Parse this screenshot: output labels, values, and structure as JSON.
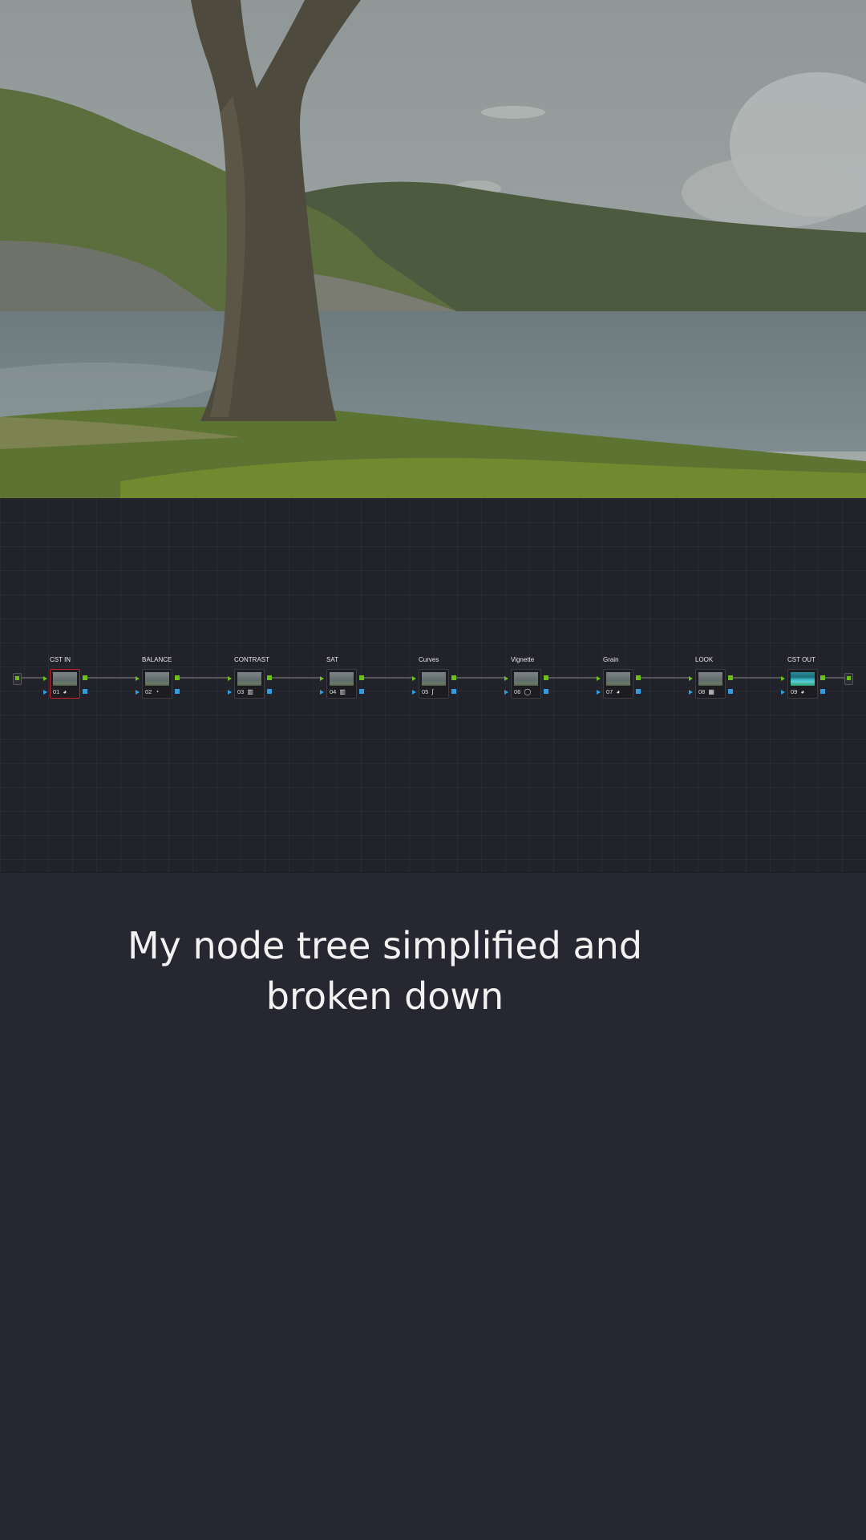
{
  "caption": "My node tree simplified and broken down",
  "viewer": {
    "image": "landscape-tree-bay-photo"
  },
  "colors": {
    "background": "#272731",
    "node_editor": "#22222b",
    "wire": "#8a8a8a",
    "rgb_port": "#6cbf1b",
    "alpha_port": "#2f9de0",
    "selected_border": "#c3222a"
  },
  "nodes": [
    {
      "label": "CST IN",
      "number": "01",
      "icon": "color-space-icon",
      "glyph": "◕",
      "selected": true
    },
    {
      "label": "BALANCE",
      "number": "02",
      "icon": "color-wheels-icon",
      "glyph": "◔",
      "selected": false
    },
    {
      "label": "CONTRAST",
      "number": "03",
      "icon": "primaries-bars-icon",
      "glyph": "▥",
      "selected": false
    },
    {
      "label": "SAT",
      "number": "04",
      "icon": "primaries-bars-icon",
      "glyph": "▥",
      "selected": false
    },
    {
      "label": "Curves",
      "number": "05",
      "icon": "curves-icon",
      "glyph": "∫",
      "selected": false
    },
    {
      "label": "Vignette",
      "number": "06",
      "icon": "power-window-icon",
      "glyph": "◯",
      "selected": false
    },
    {
      "label": "Grain",
      "number": "07",
      "icon": "effect-icon",
      "glyph": "◕",
      "selected": false
    },
    {
      "label": "LOOK",
      "number": "08",
      "icon": "lut-icon",
      "glyph": "▦",
      "selected": false
    },
    {
      "label": "CST OUT",
      "number": "09",
      "icon": "color-space-icon",
      "glyph": "◕",
      "selected": false
    }
  ]
}
